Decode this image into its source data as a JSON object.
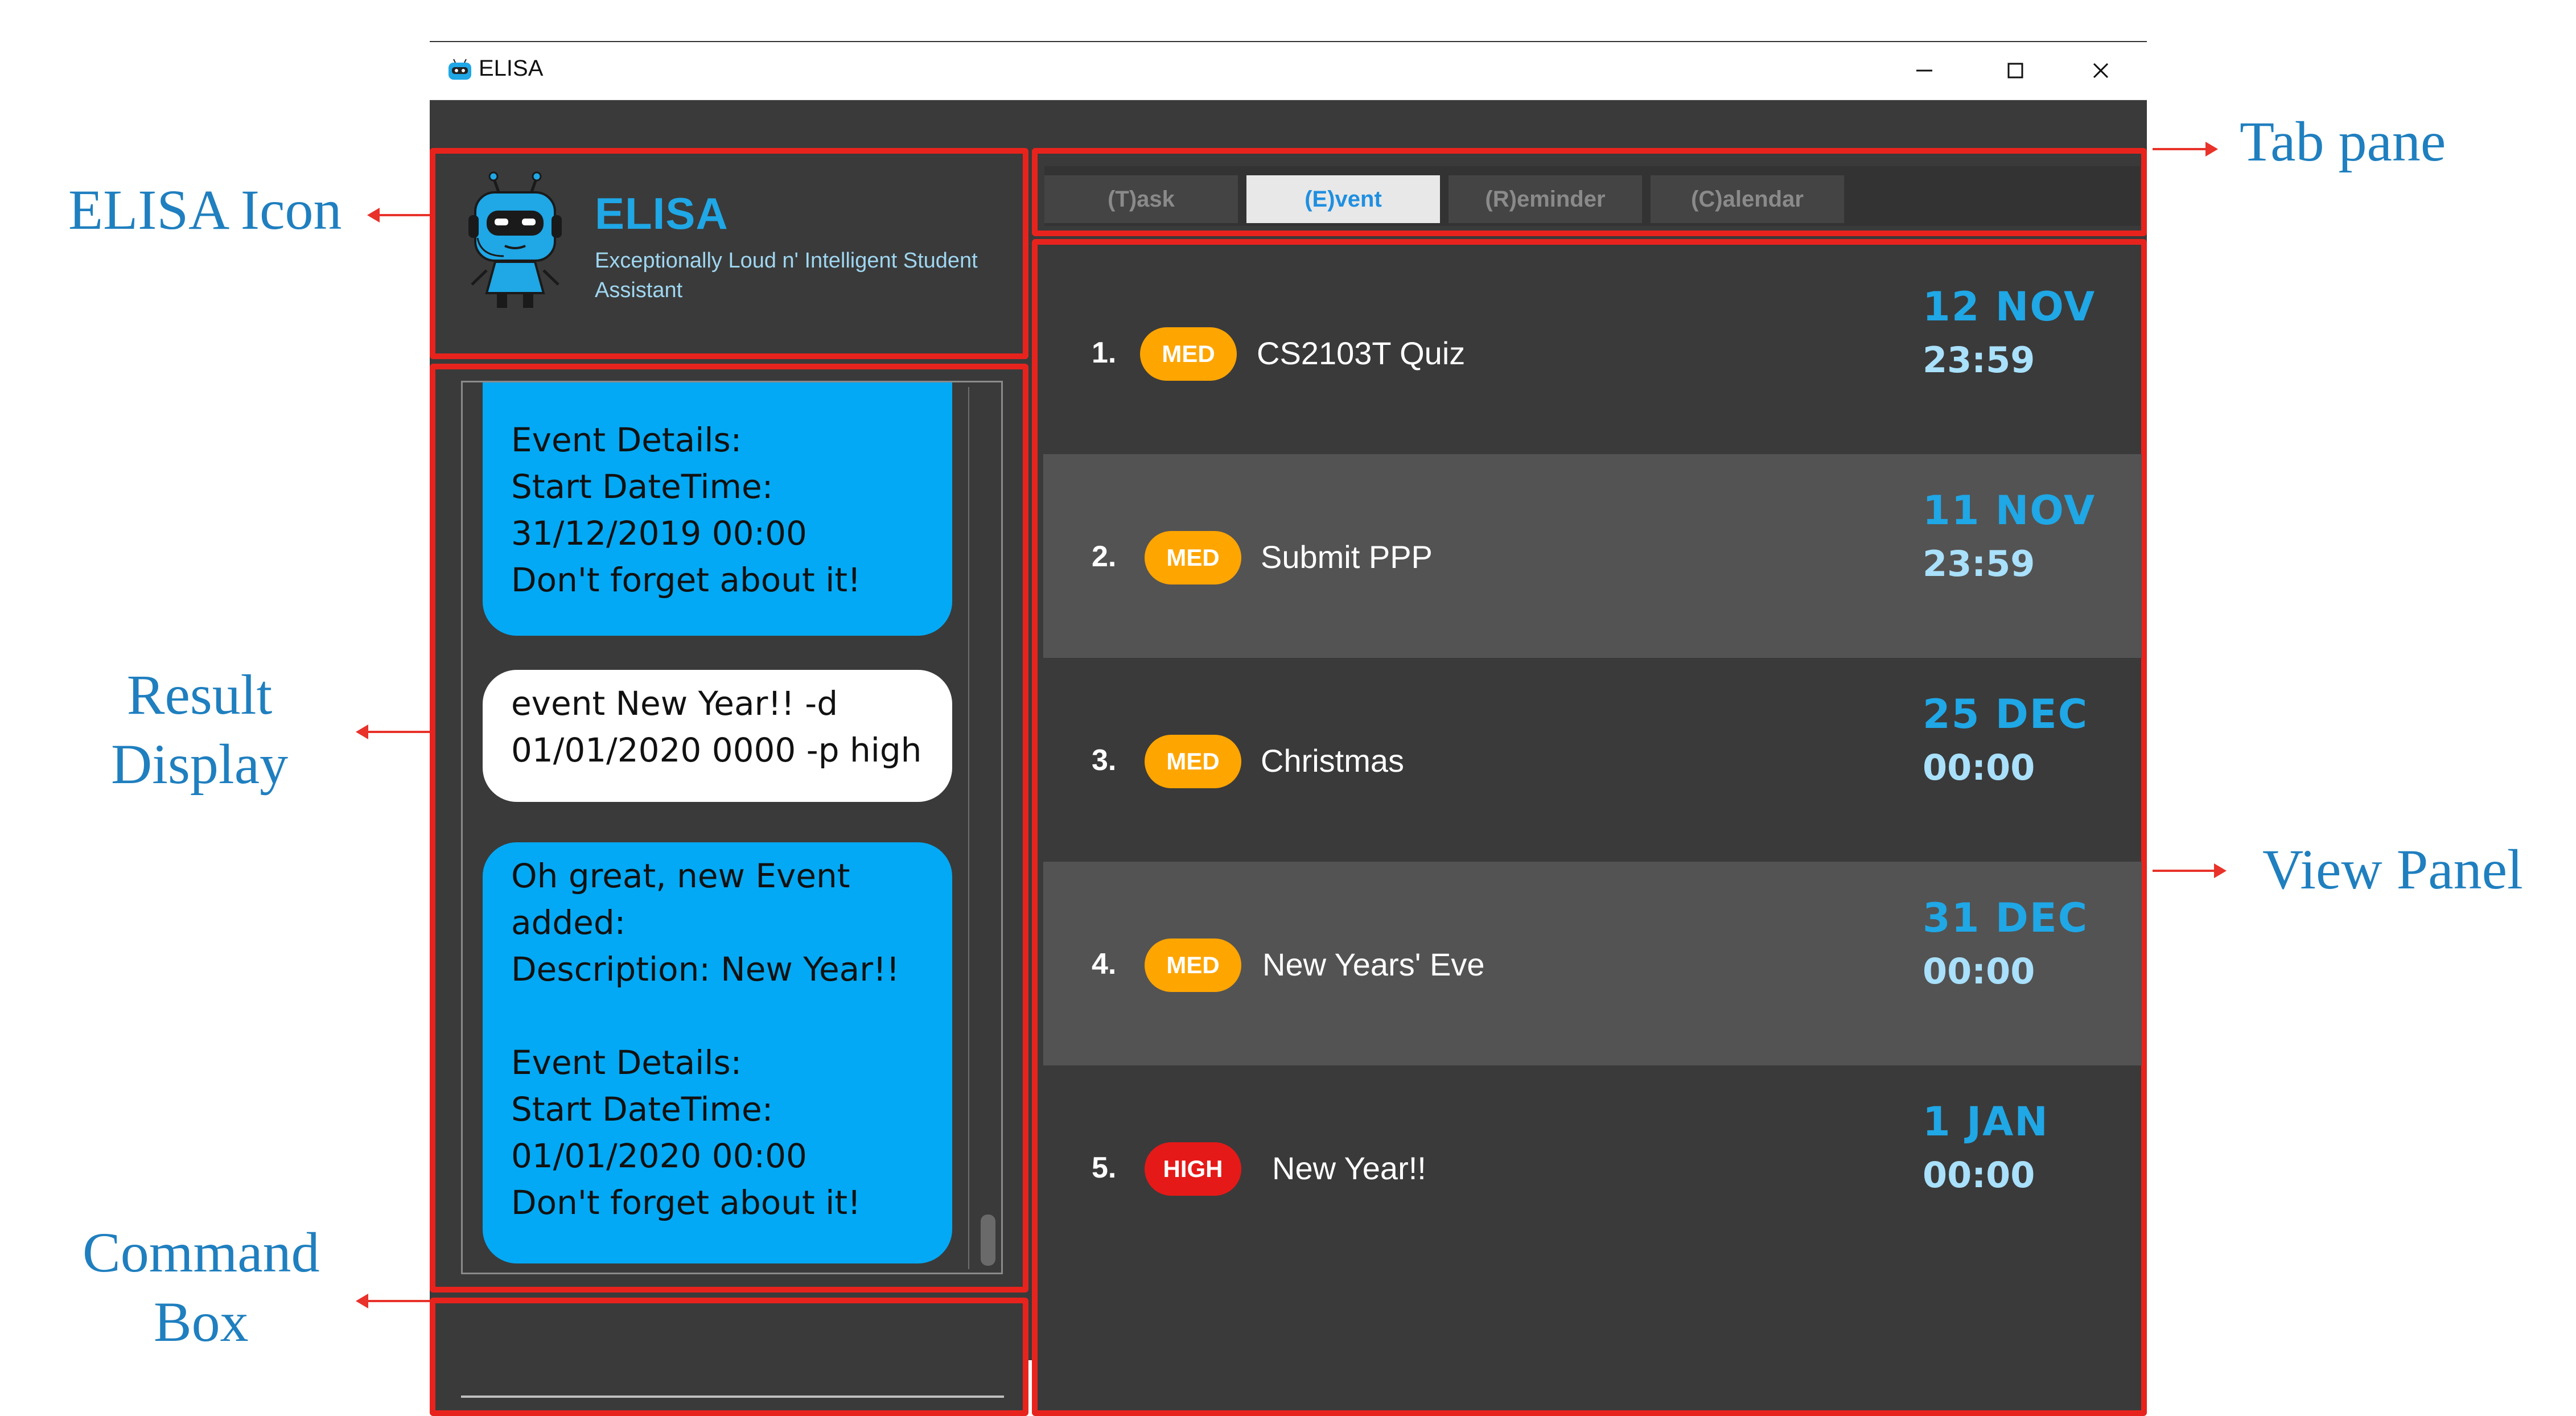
{
  "annotations": {
    "elisa_icon": "ELISA Icon",
    "result_display_line1": "Result",
    "result_display_line2": "Display",
    "command_box_line1": "Command",
    "command_box_line2": "Box",
    "tab_pane": "Tab pane",
    "view_panel": "View Panel"
  },
  "window": {
    "title": "ELISA",
    "minimize_icon": "minimize-icon",
    "maximize_icon": "maximize-icon",
    "close_icon": "close-icon"
  },
  "header": {
    "title": "ELISA",
    "subtitle": "Exceptionally Loud n' Intelligent Student Assistant"
  },
  "result_display": {
    "messages": [
      {
        "sender": "elisa",
        "text": "Event Details:\nStart DateTime:\n31/12/2019 00:00\nDon't forget about it!"
      },
      {
        "sender": "user",
        "text": "event New Year!! -d\n01/01/2020 0000 -p high"
      },
      {
        "sender": "elisa",
        "text": "Oh great, new Event\nadded:\nDescription: New Year!!\n\nEvent Details:\nStart DateTime:\n01/01/2020 00:00\nDon't forget about it!"
      }
    ]
  },
  "command_box": {
    "value": "",
    "placeholder": ""
  },
  "tabs": [
    {
      "label": "(T)ask",
      "active": false
    },
    {
      "label": "(E)vent",
      "active": true
    },
    {
      "label": "(R)eminder",
      "active": false
    },
    {
      "label": "(C)alendar",
      "active": false
    }
  ],
  "events": [
    {
      "index": "1.",
      "priority": "MED",
      "description": "CS2103T Quiz",
      "date": "12 NOV",
      "time": "23:59"
    },
    {
      "index": "2.",
      "priority": "MED",
      "description": "Submit PPP",
      "date": "11 NOV",
      "time": "23:59"
    },
    {
      "index": "3.",
      "priority": "MED",
      "description": "Christmas",
      "date": "25 DEC",
      "time": "00:00"
    },
    {
      "index": "4.",
      "priority": "MED",
      "description": "New Years' Eve",
      "date": "31 DEC",
      "time": "00:00"
    },
    {
      "index": "5.",
      "priority": "HIGH",
      "description": "New Year!!",
      "date": "1 JAN",
      "time": "00:00"
    }
  ],
  "colors": {
    "accent": "#1fa7e6",
    "elisa_bubble": "#03a9f4",
    "med_badge": "#ffa500",
    "high_badge": "#e61919",
    "annotation_box": "#e8231d"
  }
}
